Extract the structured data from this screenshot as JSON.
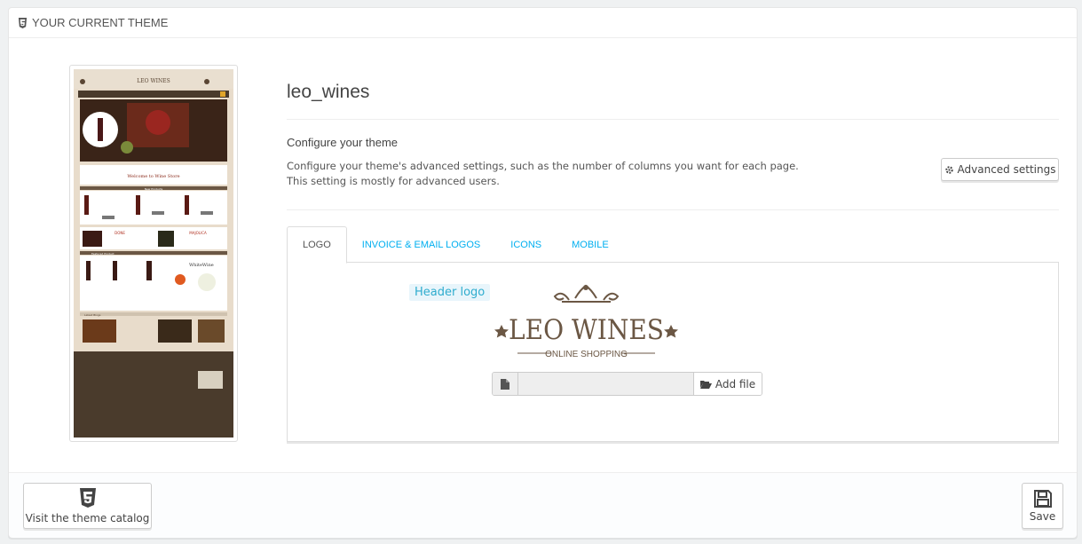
{
  "panel": {
    "heading": "Your current theme"
  },
  "theme": {
    "name": "leo_wines",
    "configure_title": "Configure your theme",
    "configure_desc_line1": "Configure your theme's advanced settings, such as the number of columns you want for each page.",
    "configure_desc_line2": "This setting is mostly for advanced users.",
    "advanced_button": "Advanced settings"
  },
  "tabs": [
    {
      "label": "Logo",
      "active": true
    },
    {
      "label": "Invoice & Email Logos",
      "active": false
    },
    {
      "label": "Icons",
      "active": false
    },
    {
      "label": "Mobile",
      "active": false
    }
  ],
  "logo_tab": {
    "header_logo_label": "Header logo",
    "logo_text_main": "LEO WINES",
    "logo_text_sub": "ONLINE SHOPPING",
    "file_input_value": "",
    "add_file_label": "Add file"
  },
  "footer": {
    "catalog_button": "Visit the theme catalog",
    "save_button": "Save"
  },
  "preview": {
    "logo_text": "LEO WINES",
    "welcome_text": "Welcome to Wine Store",
    "new_products": "New Products",
    "banner_left": "DONE",
    "banner_right": "MAJOLICA",
    "featured": "Featured Product",
    "white_wine": "WhiteWine",
    "latest_blogs": "Latest Blogs"
  },
  "colors": {
    "accent": "#00aff0",
    "label_bg": "#e8f5fb",
    "logo_brown": "#6b5744",
    "preview_footer": "#4a3b2c"
  }
}
